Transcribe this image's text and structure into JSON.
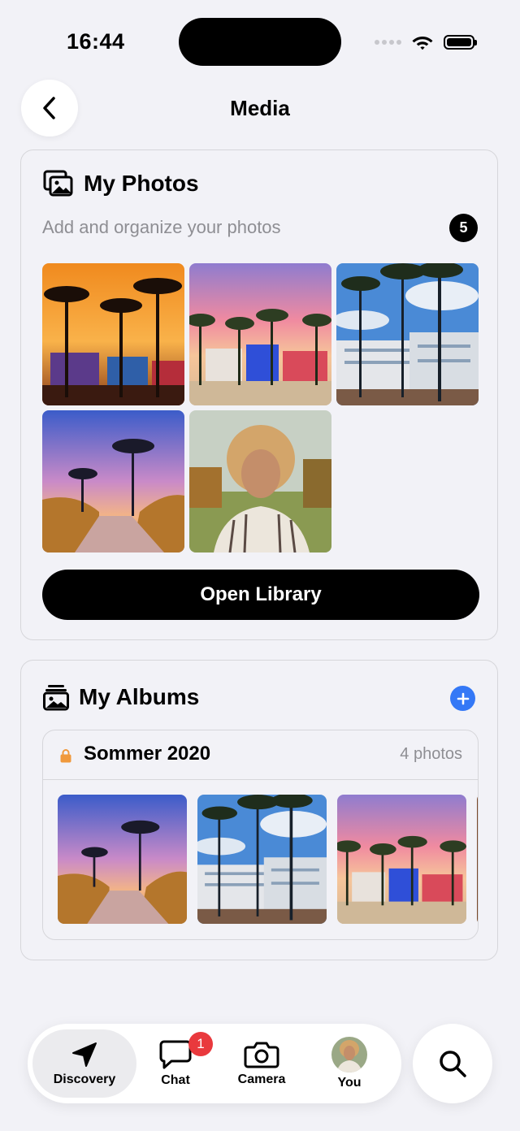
{
  "status_bar": {
    "time": "16:44",
    "icons": [
      "signal-dots-icon",
      "wifi-icon",
      "battery-icon"
    ]
  },
  "nav": {
    "title": "Media",
    "back_icon": "chevron-left-icon"
  },
  "photos": {
    "title": "My Photos",
    "icon": "photo-stack-icon",
    "subtitle": "Add and organize your photos",
    "count": "5",
    "items": [
      {
        "name": "Palm trees at sunset, Ocean Drive neon"
      },
      {
        "name": "Ocean Drive pink sky"
      },
      {
        "name": "Art deco hotels blue sky"
      },
      {
        "name": "Beach path at sunset"
      },
      {
        "name": "Portrait curly hair"
      }
    ],
    "open_library_label": "Open Library"
  },
  "albums": {
    "title": "My Albums",
    "icon": "albums-icon",
    "add_icon": "plus-icon",
    "add_color": "#3478f6",
    "list": [
      {
        "name": "Sommer 2020",
        "lock_color": "#f0993c",
        "count_label": "4 photos",
        "thumbnails": [
          "Beach path at sunset",
          "Art deco hotels blue sky",
          "Ocean Drive pink sky"
        ]
      }
    ]
  },
  "tab_bar": {
    "tabs": [
      {
        "label": "Discovery",
        "icon": "navigation-arrow-icon",
        "active": true
      },
      {
        "label": "Chat",
        "icon": "chat-bubble-icon",
        "badge": "1"
      },
      {
        "label": "Camera",
        "icon": "camera-icon"
      },
      {
        "label": "You",
        "icon": "avatar"
      }
    ],
    "badge_color": "#e9393d",
    "search_icon": "search-icon"
  }
}
